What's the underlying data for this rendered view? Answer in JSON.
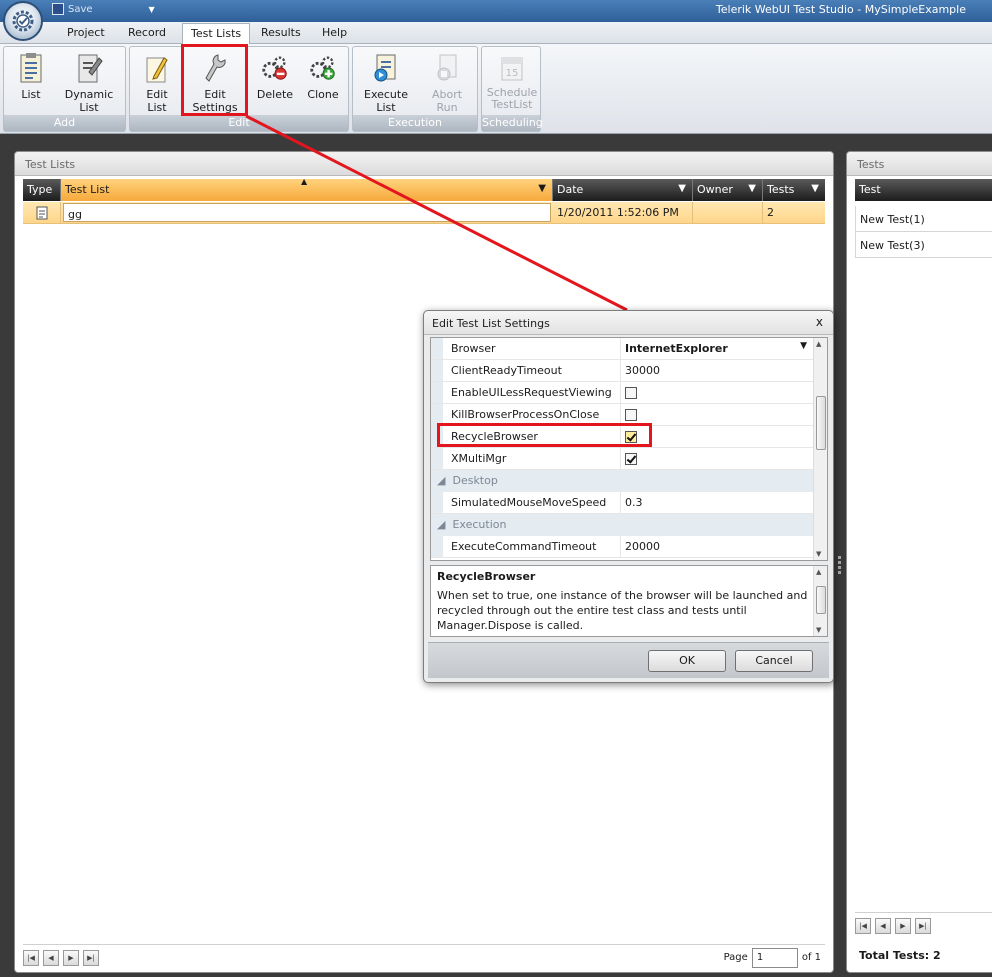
{
  "window": {
    "title": "Telerik WebUI Test Studio - MySimpleExample",
    "qat_save": "Save"
  },
  "ribbon_tabs": [
    "Project",
    "Record",
    "Test Lists",
    "Results",
    "Help"
  ],
  "ribbon_groups": {
    "add": {
      "label": "Add",
      "buttons": [
        "List",
        "Dynamic List"
      ]
    },
    "edit": {
      "label": "Edit",
      "buttons": [
        "Edit List",
        "Edit Settings",
        "Delete",
        "Clone"
      ]
    },
    "execution": {
      "label": "Execution",
      "buttons": [
        "Execute List",
        "Abort Run"
      ]
    },
    "scheduling": {
      "label": "Scheduling",
      "buttons": [
        "Schedule TestList"
      ],
      "calendar_day": "15"
    }
  },
  "test_lists_panel": {
    "title": "Test Lists",
    "columns": [
      "Type",
      "Test List",
      "Date",
      "Owner",
      "Tests"
    ],
    "rows": [
      {
        "name": "gg",
        "date": "1/20/2011 1:52:06 PM",
        "owner": "",
        "tests": "2"
      }
    ],
    "pager": {
      "page_label": "Page",
      "page_value": "1",
      "of_label": "of 1"
    }
  },
  "tests_panel": {
    "title": "Tests",
    "column": "Test",
    "rows": [
      "New Test(1)",
      "New Test(3)"
    ],
    "total": "Total Tests: 2"
  },
  "dialog": {
    "title": "Edit Test List Settings",
    "close_glyph": "x",
    "properties": [
      {
        "name": "Browser",
        "value": "InternetExplorer"
      },
      {
        "name": "ClientReadyTimeout",
        "value": "30000"
      },
      {
        "name": "EnableUILessRequestViewing",
        "checked": false
      },
      {
        "name": "KillBrowserProcessOnClose",
        "checked": false
      },
      {
        "name": "RecycleBrowser",
        "checked": true
      },
      {
        "name": "XMultiMgr",
        "checked": true
      }
    ],
    "categories": [
      "Desktop",
      "Execution"
    ],
    "desktop_props": [
      {
        "name": "SimulatedMouseMoveSpeed",
        "value": "0.3"
      }
    ],
    "execution_props": [
      {
        "name": "ExecuteCommandTimeout",
        "value": "20000"
      }
    ],
    "description_title": "RecycleBrowser",
    "description_text": "When set to true, one instance of the browser will be launched and recycled through out the entire test class and tests until Manager.Dispose is called.",
    "ok_label": "OK",
    "cancel_label": "Cancel"
  },
  "colors": {
    "highlight": "#e3161e",
    "selected_row": "#ffd58a",
    "grid_header": "#1c1c1c"
  }
}
